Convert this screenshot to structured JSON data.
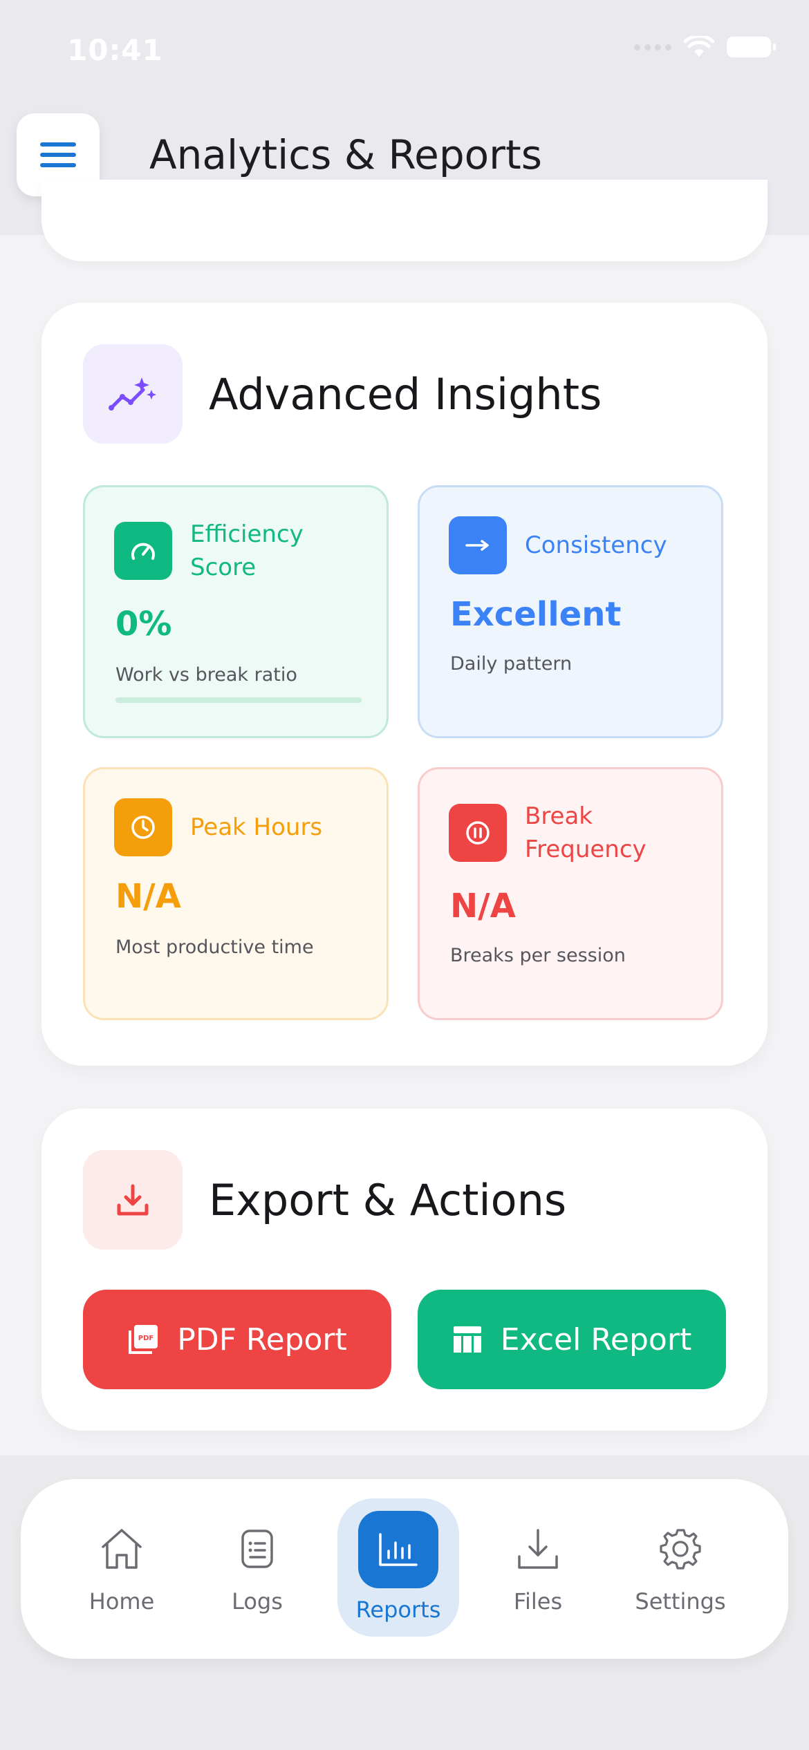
{
  "status_bar": {
    "time": "10:41"
  },
  "header": {
    "title": "Analytics & Reports",
    "menu_icon": "hamburger-menu-icon"
  },
  "insights": {
    "title": "Advanced Insights",
    "icon": "sparkle-trend-icon",
    "tiles": {
      "efficiency": {
        "label": "Efficiency Score",
        "value": "0%",
        "sub": "Work vs break ratio",
        "progress_fraction": 0,
        "color": "#10b981",
        "icon": "speedometer-icon"
      },
      "consistency": {
        "label": "Consistency",
        "value": "Excellent",
        "sub": "Daily pattern",
        "color": "#3b82f6",
        "icon": "arrow-right-icon"
      },
      "peak": {
        "label": "Peak Hours",
        "value": "N/A",
        "sub": "Most productive time",
        "color": "#f59e0b",
        "icon": "clock-icon"
      },
      "breaks": {
        "label": "Break Frequency",
        "value": "N/A",
        "sub": "Breaks per session",
        "color": "#ef4444",
        "icon": "pause-circle-icon"
      }
    }
  },
  "export": {
    "title": "Export & Actions",
    "icon": "download-icon",
    "pdf_label": "PDF Report",
    "excel_label": "Excel Report",
    "pdf_color": "#ef4444",
    "excel_color": "#10b981"
  },
  "nav": {
    "items": [
      {
        "label": "Home",
        "icon": "home-icon"
      },
      {
        "label": "Logs",
        "icon": "logs-icon"
      },
      {
        "label": "Reports",
        "icon": "bar-chart-icon",
        "active": true
      },
      {
        "label": "Files",
        "icon": "download-icon"
      },
      {
        "label": "Settings",
        "icon": "gear-icon"
      }
    ],
    "accent": "#1976d2"
  }
}
